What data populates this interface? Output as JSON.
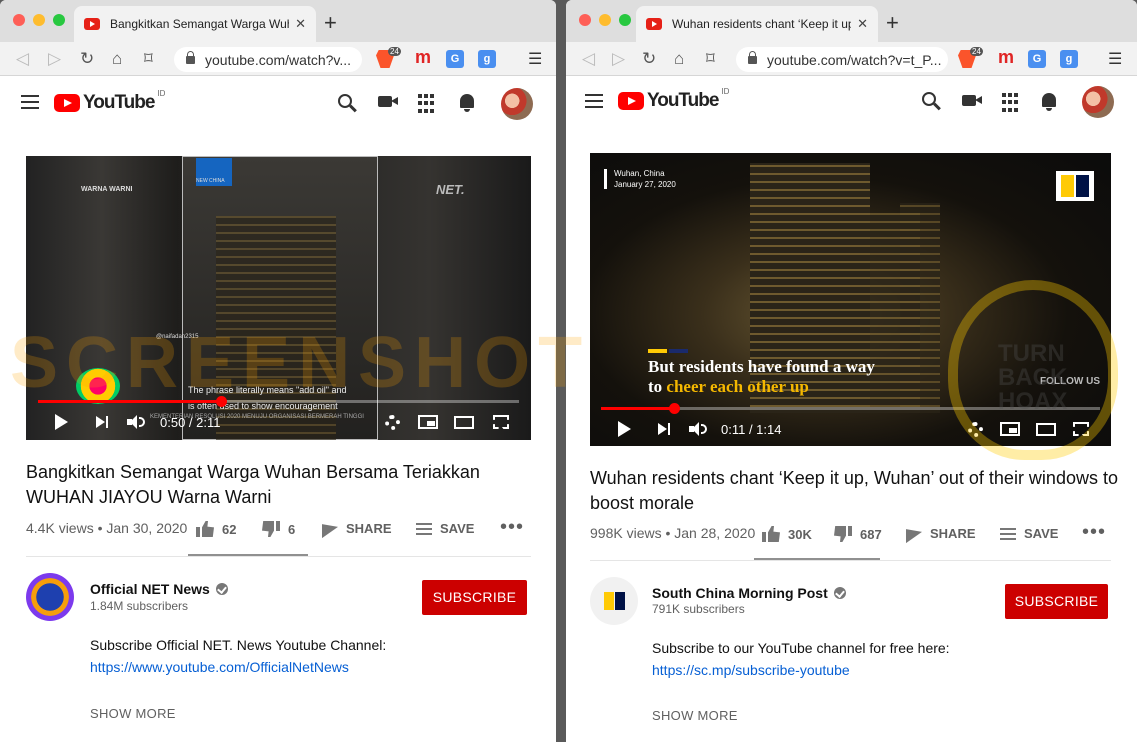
{
  "left": {
    "tab_title": "Bangkitkan Semangat Warga Wuhan",
    "url": "youtube.com/watch?v...",
    "badge": "24",
    "region": "ID",
    "logo_text": "YouTube",
    "overlay": {
      "label_tl": "WARNA WARNI",
      "label_tr": "NET.",
      "newchina": "NEW CHINA",
      "handle": "@naifadan2315",
      "sub1": "The phrase literally means \"add oil\" and",
      "sub2": "is often used to show encouragement",
      "ticker": "KEMENTERIAN RESOLUSI 2020 MENUJU ORGANISASI BERMERAH TINGGI"
    },
    "time": "0:50 / 2:11",
    "progress": 0.38,
    "title": "Bangkitkan Semangat Warga Wuhan Bersama Teriakkan WUHAN JIAYOU Warna Warni",
    "views": "4.4K views • Jan 30, 2020",
    "likes": "62",
    "dislikes": "6",
    "share": "SHARE",
    "save": "SAVE",
    "channel": "Official NET News",
    "subscribers": "1.84M subscribers",
    "subscribe": "SUBSCRIBE",
    "desc_line": "Subscribe Official NET. News Youtube Channel:",
    "desc_link": "https://www.youtube.com/OfficialNetNews",
    "show_more": "SHOW MORE"
  },
  "right": {
    "tab_title": "Wuhan residents chant ‘Keep it up",
    "url": "youtube.com/watch?v=t_P...",
    "badge": "24",
    "region": "ID",
    "logo_text": "YouTube",
    "overlay": {
      "place": "Wuhan, China",
      "date": "January 27, 2020",
      "caption1": "But residents have found a way",
      "caption2a": "to ",
      "caption2b": "cheer each other up",
      "follow": "FOLLOW US"
    },
    "time": "0:11 / 1:14",
    "progress": 0.147,
    "title": "Wuhan residents chant ‘Keep it up, Wuhan’ out of their windows to boost morale",
    "views": "998K views • Jan 28, 2020",
    "likes": "30K",
    "dislikes": "687",
    "share": "SHARE",
    "save": "SAVE",
    "channel": "South China Morning Post",
    "subscribers": "791K subscribers",
    "subscribe": "SUBSCRIBE",
    "desc_line": "Subscribe to our YouTube channel for free here:",
    "desc_link": "https://sc.mp/subscribe-youtube",
    "show_more": "SHOW MORE"
  },
  "watermark": "SCREENSHOT",
  "seal_text": [
    "TURN",
    "BACK",
    "HOAX"
  ],
  "colors": {
    "accent": "#cc0000",
    "link": "#065fd4",
    "scmp_yellow": "#ffca05",
    "scmp_blue": "#001246"
  }
}
